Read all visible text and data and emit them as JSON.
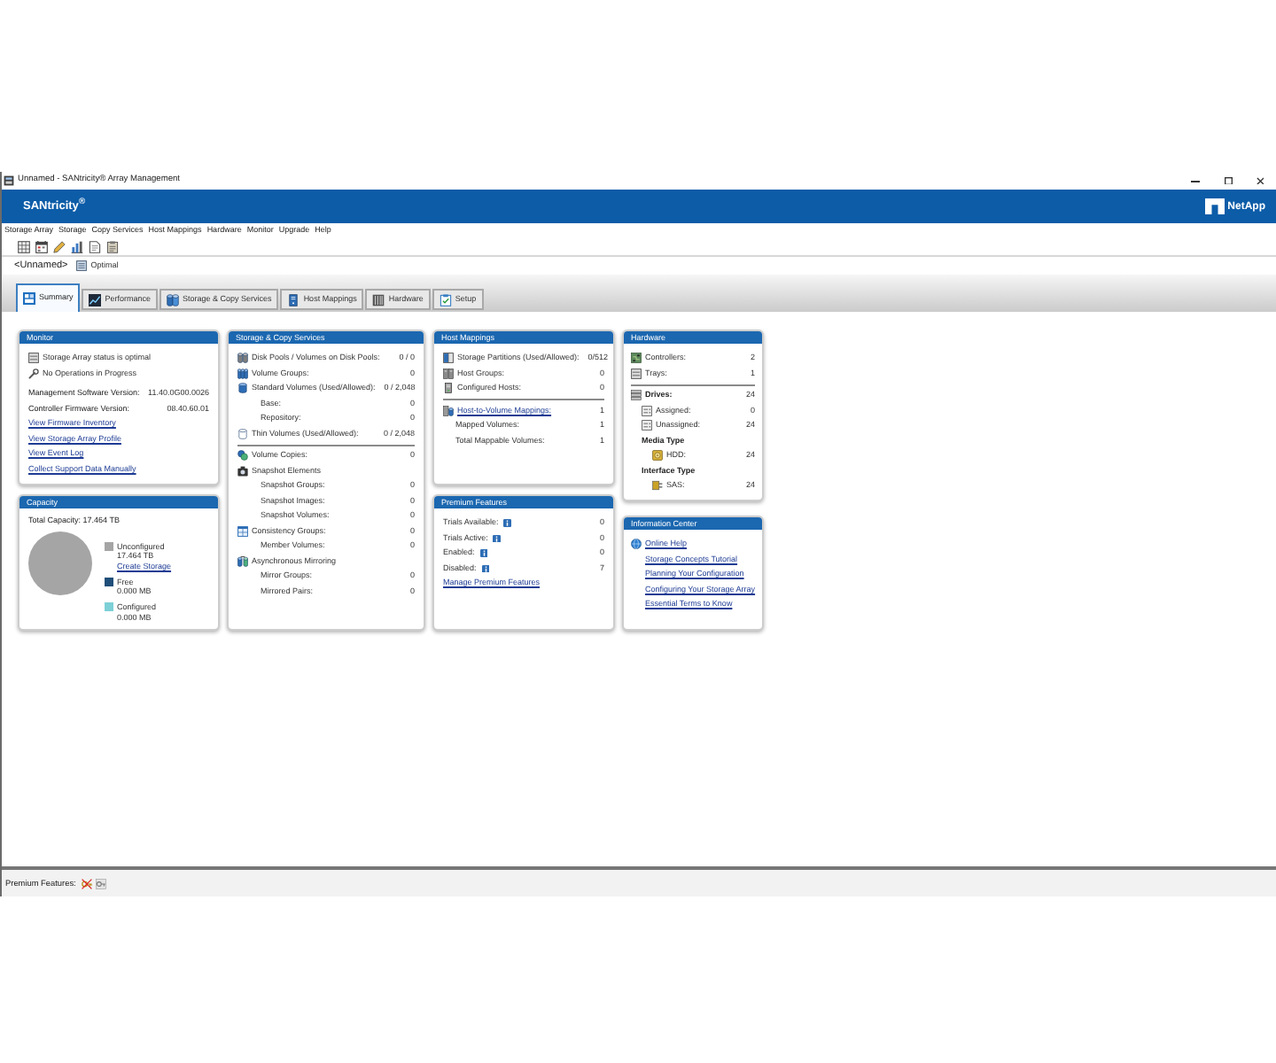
{
  "window": {
    "title": "Unnamed - SANtricity® Array Management"
  },
  "banner": {
    "product": "SANtricity$^{®}$",
    "vendor": "NetApp"
  },
  "menu": [
    "Storage Array",
    "Storage",
    "Copy Services",
    "Host Mappings",
    "Hardware",
    "Monitor",
    "Upgrade",
    "Help"
  ],
  "array_bar": {
    "name": "<Unnamed>",
    "status": "Optimal"
  },
  "tabs": [
    {
      "label": "Summary",
      "selected": true
    },
    {
      "label": "Performance",
      "selected": false
    },
    {
      "label": "Storage & Copy Services",
      "selected": false
    },
    {
      "label": "Host Mappings",
      "selected": false
    },
    {
      "label": "Hardware",
      "selected": false
    },
    {
      "label": "Setup",
      "selected": false
    }
  ],
  "monitor": {
    "title": "Monitor",
    "status": [
      "Storage Array status is optimal",
      "No Operations in Progress"
    ],
    "versions": [
      {
        "label": "Management Software Version:",
        "value": "11.40.0G00.0026"
      },
      {
        "label": "Controller Firmware Version:",
        "value": "08.40.60.01"
      }
    ],
    "links": [
      "View Firmware Inventory",
      "View Storage Array Profile",
      "View Event Log",
      "Collect Support Data Manually"
    ]
  },
  "capacity": {
    "title": "Capacity",
    "total": "Total Capacity: 17.464 TB",
    "legend": [
      {
        "label": "Unconfigured",
        "value": "17.464 TB",
        "link": "Create Storage",
        "color": "#a5a5a5"
      },
      {
        "label": "Free",
        "value": "0.000 MB",
        "color": "#1f4e79"
      },
      {
        "label": "Configured",
        "value": "0.000 MB",
        "color": "#7dd0d6"
      }
    ]
  },
  "storage_copy_services": {
    "title": "Storage & Copy Services",
    "sections": [
      {
        "rows": [
          {
            "kind": "icon",
            "label": "Disk Pools / Volumes on Disk Pools:",
            "value": "0 / 0"
          },
          {
            "kind": "icon",
            "label": "Volume Groups:",
            "value": "0"
          },
          {
            "kind": "icon",
            "label": "Standard Volumes (Used/Allowed):",
            "value": "0 / 2,048",
            "children": [
              {
                "kind": "plain",
                "label": "Base:",
                "value": "0"
              },
              {
                "kind": "plain",
                "label": "Repository:",
                "value": "0"
              }
            ]
          },
          {
            "kind": "icon",
            "label": "Thin Volumes (Used/Allowed):",
            "value": "0 / 2,048"
          }
        ]
      },
      {
        "rows": [
          {
            "kind": "icon",
            "label": "Volume Copies:",
            "value": "0"
          },
          {
            "kind": "icon",
            "label": "Snapshot Elements",
            "children": [
              {
                "kind": "plain",
                "label": "Snapshot Groups:",
                "value": "0"
              },
              {
                "kind": "plain",
                "label": "Snapshot Images:",
                "value": "0"
              },
              {
                "kind": "plain",
                "label": "Snapshot Volumes:",
                "value": "0"
              }
            ]
          },
          {
            "kind": "icon",
            "label": "Consistency Groups:",
            "value": "0",
            "children": [
              {
                "kind": "plain",
                "label": "Member Volumes:",
                "value": "0"
              }
            ]
          },
          {
            "kind": "icon",
            "label": "Asynchronous Mirroring",
            "children": [
              {
                "kind": "plain",
                "label": "Mirror Groups:",
                "value": "0"
              },
              {
                "kind": "plain",
                "label": "Mirrored Pairs:",
                "value": "0"
              }
            ]
          }
        ]
      }
    ]
  },
  "host_mappings": {
    "title": "Host Mappings",
    "sections": [
      {
        "rows": [
          {
            "kind": "icon",
            "label": "Storage Partitions (Used/Allowed):",
            "value": "0/512"
          },
          {
            "kind": "icon",
            "label": "Host Groups:",
            "value": "0"
          },
          {
            "kind": "icon",
            "label": "Configured Hosts:",
            "value": "0"
          }
        ]
      },
      {
        "rows": [
          {
            "kind": "icon_link",
            "label": "Host-to-Volume Mappings:",
            "value": "1",
            "children": [
              {
                "kind": "plain",
                "label": "Mapped Volumes:",
                "value": "1"
              },
              {
                "kind": "plain",
                "label": "Total Mappable Volumes:",
                "value": "1"
              }
            ]
          }
        ]
      }
    ]
  },
  "premium_features": {
    "title": "Premium Features",
    "rows": [
      {
        "kind": "hint",
        "label": "Trials Available:",
        "value": "0"
      },
      {
        "kind": "hint",
        "label": "Trials Active:",
        "value": "0"
      },
      {
        "kind": "hint",
        "label": "Enabled:",
        "value": "0"
      },
      {
        "kind": "hint",
        "label": "Disabled:",
        "value": "7"
      },
      {
        "kind": "link",
        "label": "Manage Premium Features"
      }
    ]
  },
  "hardware": {
    "title": "Hardware",
    "sections": [
      {
        "rows": [
          {
            "kind": "icon",
            "label": "Controllers:",
            "value": "2"
          },
          {
            "kind": "icon",
            "label": "Trays:",
            "value": "1"
          }
        ]
      },
      {
        "rows": [
          {
            "kind": "icon_heading",
            "label": "Drives:",
            "value": "24",
            "children": [
              {
                "kind": "icon",
                "label": "Assigned:",
                "value": "0"
              },
              {
                "kind": "icon",
                "label": "Unassigned:",
                "value": "24"
              },
              {
                "kind": "heading",
                "label": "Media Type",
                "children": [
                  {
                    "kind": "icon",
                    "label": "HDD:",
                    "value": "24"
                  }
                ]
              },
              {
                "kind": "heading",
                "label": "Interface Type",
                "children": [
                  {
                    "kind": "icon",
                    "label": "SAS:",
                    "value": "24"
                  }
                ]
              }
            ]
          }
        ]
      }
    ]
  },
  "information_center": {
    "title": "Information Center",
    "rows": [
      {
        "kind": "icon_link",
        "label": "Online Help",
        "children": [
          {
            "kind": "link",
            "label": "Storage Concepts Tutorial"
          },
          {
            "kind": "link",
            "label": "Planning Your Configuration"
          },
          {
            "kind": "link",
            "label": "Configuring Your Storage Array"
          },
          {
            "kind": "link",
            "label": "Essential Terms to Know"
          }
        ]
      }
    ]
  },
  "status_bar": {
    "label": "Premium Features:"
  }
}
